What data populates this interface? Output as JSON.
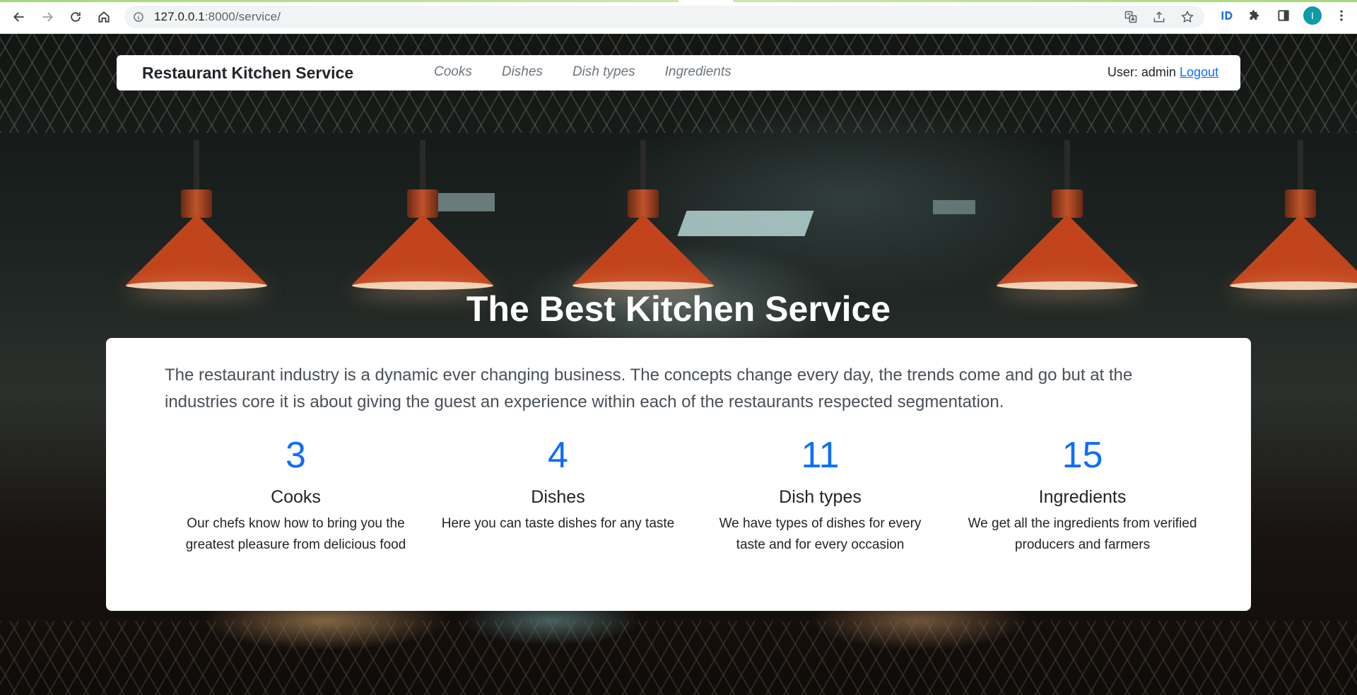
{
  "browser": {
    "url_host": "127.0.0.1",
    "url_rest": ":8000/service/",
    "avatar_letter": "I"
  },
  "navbar": {
    "brand": "Restaurant Kitchen Service",
    "links": [
      "Cooks",
      "Dishes",
      "Dish types",
      "Ingredients"
    ],
    "user_label": "User: admin",
    "logout": "Logout"
  },
  "hero": {
    "title": "The Best Kitchen Service",
    "lead": "The restaurant industry is a dynamic ever changing business. The concepts change every day, the trends come and go but at the industries core it is about giving the guest an experience within each of the restaurants respected segmentation."
  },
  "stats": [
    {
      "count": "3",
      "label": "Cooks",
      "desc": "Our chefs know how to bring you the greatest pleasure from delicious food"
    },
    {
      "count": "4",
      "label": "Dishes",
      "desc": "Here you can taste dishes for any taste"
    },
    {
      "count": "11",
      "label": "Dish types",
      "desc": "We have types of dishes for every taste and for every occasion"
    },
    {
      "count": "15",
      "label": "Ingredients",
      "desc": "We get all the ingredients from verified producers and farmers"
    }
  ],
  "colors": {
    "accent": "#0d6efd",
    "brand_text": "#212529",
    "nav_link": "#6c757d"
  },
  "icons": [
    "back-icon",
    "forward-icon",
    "reload-icon",
    "home-icon",
    "info-icon",
    "translate-icon",
    "share-icon",
    "star-icon",
    "extension-id-icon",
    "puzzle-icon",
    "sidepanel-icon",
    "menu-dots-icon"
  ]
}
